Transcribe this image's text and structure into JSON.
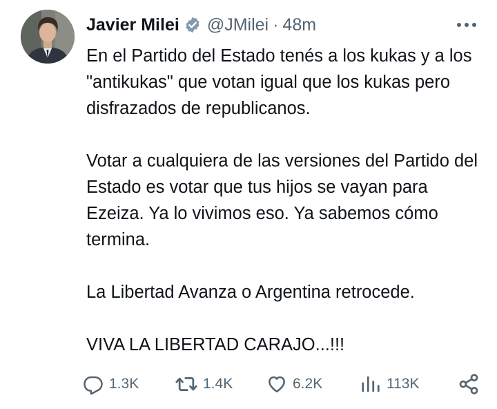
{
  "tweet": {
    "author": {
      "name": "Javier Milei",
      "handle": "@JMilei",
      "separator": "·",
      "time": "48m"
    },
    "paragraphs": [
      "En el Partido del Estado tenés a los kukas y a los \"antikukas\" que votan igual que los kukas pero disfrazados de republicanos.",
      "Votar a cualquiera de las versiones del Partido del Estado es votar que tus hijos se vayan para Ezeiza. Ya lo vivimos eso. Ya sabemos cómo termina.",
      "La Libertad Avanza o Argentina retrocede.",
      "VIVA LA LIBERTAD CARAJO...!!!"
    ],
    "actions": {
      "replies": "1.3K",
      "reposts": "1.4K",
      "likes": "6.2K",
      "views": "113K"
    }
  },
  "colors": {
    "text": "#0f1419",
    "secondary": "#536471",
    "verified_badge": "#829aab"
  },
  "icons": [
    "verified-badge-icon",
    "more-icon",
    "reply-icon",
    "repost-icon",
    "like-icon",
    "views-icon",
    "share-icon"
  ]
}
